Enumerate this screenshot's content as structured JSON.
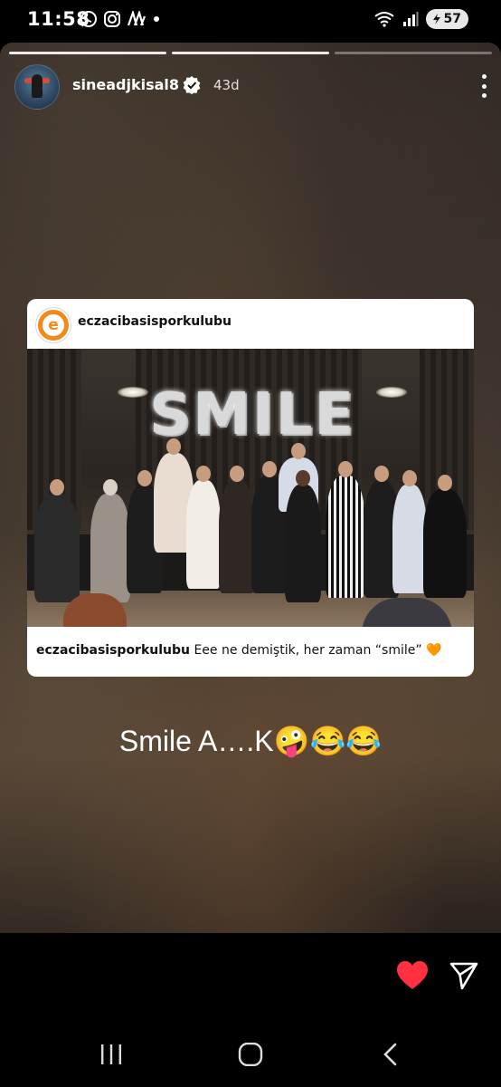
{
  "status_bar": {
    "time": "11:58",
    "battery": "57",
    "notification_icons": [
      "whatsapp-icon",
      "instagram-icon",
      "app-icon",
      "dot-icon"
    ],
    "system_icons": [
      "wifi-icon",
      "signal-icon",
      "battery-icon"
    ]
  },
  "story": {
    "progress_segments": 3,
    "active_segment": 1,
    "username": "sineadjkisal8",
    "verified": true,
    "age": "43d"
  },
  "shared_post": {
    "username": "eczacibasisporkulubu",
    "avatar_letter": "e",
    "photo_balloon_text": "SMILE",
    "caption_user": "eczacibasisporkulubu",
    "caption_text": " Eee ne demiştik, her zaman “smile” 🧡"
  },
  "story_text": "Smile A….K🤪😂😂",
  "actions": {
    "like_icon": "heart-icon",
    "share_icon": "send-icon",
    "liked": true,
    "like_color": "#ff3040"
  },
  "navigation": [
    "recents-icon",
    "home-icon",
    "back-icon"
  ]
}
